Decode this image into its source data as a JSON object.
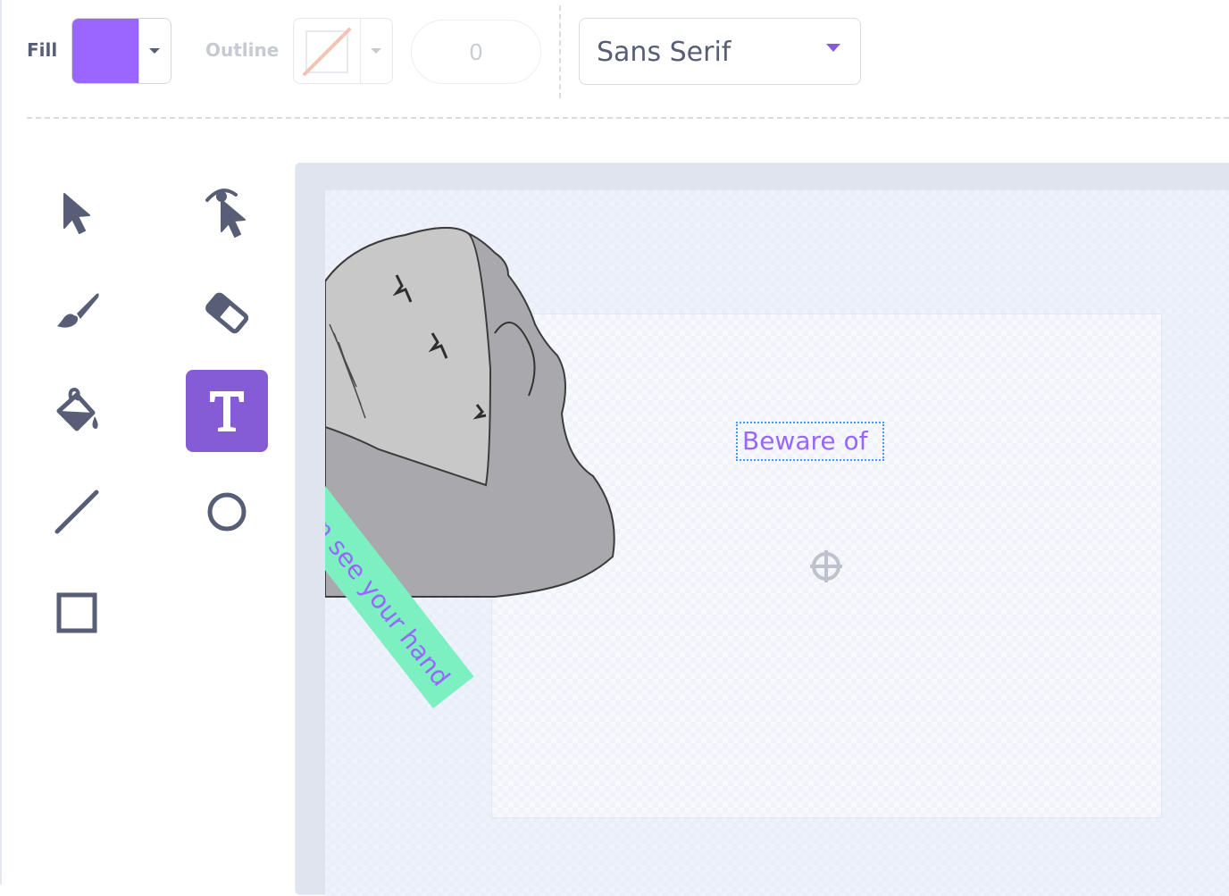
{
  "toolbar": {
    "fill_label": "Fill",
    "fill_color": "#9966ff",
    "outline_label": "Outline",
    "outline_width": "0",
    "font_name": "Sans Serif"
  },
  "tools": [
    {
      "name": "select",
      "icon": "arrow-pointer-icon",
      "active": false
    },
    {
      "name": "reshape",
      "icon": "reshape-pointer-icon",
      "active": false
    },
    {
      "name": "brush",
      "icon": "brush-icon",
      "active": false
    },
    {
      "name": "eraser",
      "icon": "eraser-icon",
      "active": false
    },
    {
      "name": "fill",
      "icon": "paint-bucket-icon",
      "active": false
    },
    {
      "name": "text",
      "icon": "text-t-icon",
      "active": true
    },
    {
      "name": "line",
      "icon": "line-icon",
      "active": false
    },
    {
      "name": "circle",
      "icon": "circle-icon",
      "active": false
    },
    {
      "name": "rectangle",
      "icon": "rectangle-icon",
      "active": false
    }
  ],
  "canvas": {
    "editing_text": "Beware of",
    "rotated_text": "n see your hand",
    "rotated_text_bg": "#7cf0c1"
  },
  "colors": {
    "accent": "#855cd6",
    "text_purple": "#9966ff",
    "icon_gray": "#575e75"
  }
}
